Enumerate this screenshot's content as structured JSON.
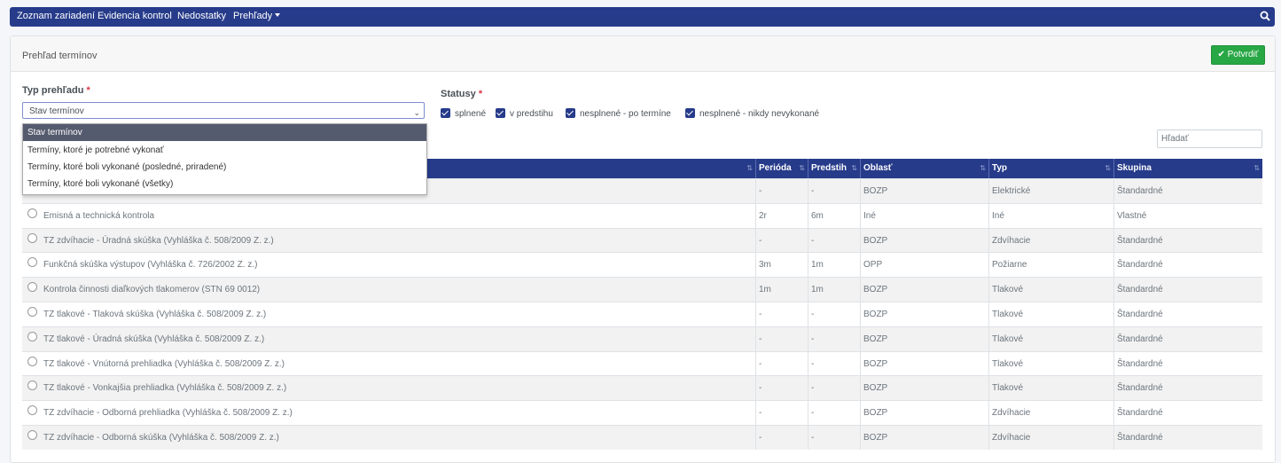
{
  "nav": {
    "items": [
      "Zoznam zariadení",
      "Evidencia kontrol",
      "Nedostatky",
      "Prehľady"
    ],
    "search_icon": "search-icon"
  },
  "card": {
    "title": "Prehľad termínov",
    "confirm_label": "Potvrdiť"
  },
  "form": {
    "type_label": "Typ prehľadu",
    "required_mark": "*",
    "type_selected": "Stav termínov",
    "type_options": [
      "Stav termínov",
      "Termíny, ktoré je potrebné vykonať",
      "Termíny, ktoré boli vykonané (posledné, priradené)",
      "Termíny, ktoré boli vykonané (všetky)"
    ],
    "status_label": "Statusy",
    "statuses": [
      {
        "label": "splnené",
        "checked": true
      },
      {
        "label": "v predstihu",
        "checked": true
      },
      {
        "label": "nesplnené - po termíne",
        "checked": true
      },
      {
        "label": "nesplnené - nikdy nevykonané",
        "checked": true
      }
    ],
    "search_placeholder": "Hľadať"
  },
  "table": {
    "headers": [
      "Perióda",
      "Predstih",
      "Oblasť",
      "Typ",
      "Skupina"
    ],
    "rows": [
      {
        "name": "",
        "period": "-",
        "advance": "-",
        "area": "BOZP",
        "type": "Elektrické",
        "group": "Štandardné"
      },
      {
        "name": "Emisná a technická kontrola",
        "period": "2r",
        "advance": "6m",
        "area": "Iné",
        "type": "Iné",
        "group": "Vlastné"
      },
      {
        "name": "TZ zdvíhacie - Úradná skúška (Vyhláška č. 508/2009 Z. z.)",
        "period": "-",
        "advance": "-",
        "area": "BOZP",
        "type": "Zdvíhacie",
        "group": "Štandardné"
      },
      {
        "name": "Funkčná skúška výstupov (Vyhláška č. 726/2002 Z. z.)",
        "period": "3m",
        "advance": "1m",
        "area": "OPP",
        "type": "Požiarne",
        "group": "Štandardné"
      },
      {
        "name": "Kontrola činnosti diaľkových tlakomerov (STN 69 0012)",
        "period": "1m",
        "advance": "1m",
        "area": "BOZP",
        "type": "Tlakové",
        "group": "Štandardné"
      },
      {
        "name": "TZ tlakové - Tlaková skúška (Vyhláška č. 508/2009 Z. z.)",
        "period": "-",
        "advance": "-",
        "area": "BOZP",
        "type": "Tlakové",
        "group": "Štandardné"
      },
      {
        "name": "TZ tlakové - Úradná skúška (Vyhláška č. 508/2009 Z. z.)",
        "period": "-",
        "advance": "-",
        "area": "BOZP",
        "type": "Tlakové",
        "group": "Štandardné"
      },
      {
        "name": "TZ tlakové - Vnútorná prehliadka (Vyhláška č. 508/2009 Z. z.)",
        "period": "-",
        "advance": "-",
        "area": "BOZP",
        "type": "Tlakové",
        "group": "Štandardné"
      },
      {
        "name": "TZ tlakové - Vonkajšia prehliadka (Vyhláška č. 508/2009 Z. z.)",
        "period": "-",
        "advance": "-",
        "area": "BOZP",
        "type": "Tlakové",
        "group": "Štandardné"
      },
      {
        "name": "TZ zdvíhacie - Odborná prehliadka (Vyhláška č. 508/2009 Z. z.)",
        "period": "-",
        "advance": "-",
        "area": "BOZP",
        "type": "Zdvíhacie",
        "group": "Štandardné"
      },
      {
        "name": "TZ zdvíhacie - Odborná skúška (Vyhláška č. 508/2009 Z. z.)",
        "period": "-",
        "advance": "-",
        "area": "BOZP",
        "type": "Zdvíhacie",
        "group": "Štandardné"
      }
    ]
  },
  "colors": {
    "brand": "#263b8a",
    "confirm": "#28a745",
    "required": "#dc3545"
  }
}
